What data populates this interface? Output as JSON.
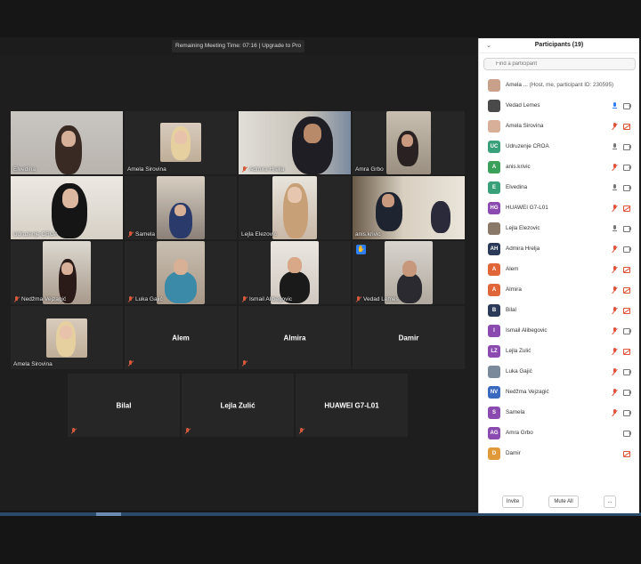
{
  "meeting": {
    "timer_text": "Remaining Meeting Time: 07:16 | Upgrade to Pro"
  },
  "tiles": [
    {
      "name": "Elvedina"
    },
    {
      "name": "Amela Sirovina"
    },
    {
      "name": "Admira Hrelja"
    },
    {
      "name": "Amra Grbo"
    },
    {
      "name": "Udruzenje CROA"
    },
    {
      "name": "Samela"
    },
    {
      "name": "Lejla Elezovic"
    },
    {
      "name": "anis.krivic"
    },
    {
      "name": "Nedžma Vejzagić"
    },
    {
      "name": "Luka Gajić"
    },
    {
      "name": "Ismail Alibegovic"
    },
    {
      "name": "Vedad Lemes"
    },
    {
      "name": "Amela Sirovina"
    },
    {
      "name": "Alem"
    },
    {
      "name": "Almira"
    },
    {
      "name": "Damir"
    },
    {
      "name": "Bilal"
    },
    {
      "name": "Lejla Zulić"
    },
    {
      "name": "HUAWEI G7-L01"
    }
  ],
  "participants_panel": {
    "title": "Participants (19)",
    "search_placeholder": "Find a participant",
    "invite_label": "Invite",
    "mute_all_label": "Mute All",
    "more_label": "...",
    "participants": [
      {
        "name": "Amela ...",
        "extra": "(Host, me, participant ID: 230595)",
        "initials": "",
        "avatar_color": "#c9a08a",
        "mic": "none",
        "cam": "none"
      },
      {
        "name": "Vedad Lemes",
        "initials": "",
        "avatar_color": "#4a4a4a",
        "mic": "blue",
        "cam": "ok"
      },
      {
        "name": "Amela Sirovina",
        "initials": "",
        "avatar_color": "#d8b09a",
        "mic": "red",
        "cam": "red"
      },
      {
        "name": "Udruzenje CROA",
        "initials": "UC",
        "avatar_color": "#3aa07a",
        "mic": "ok",
        "cam": "ok"
      },
      {
        "name": "anis.krivic",
        "initials": "A",
        "avatar_color": "#3aa05a",
        "mic": "red",
        "cam": "ok"
      },
      {
        "name": "Elvedina",
        "initials": "E",
        "avatar_color": "#3aa07a",
        "mic": "ok",
        "cam": "ok"
      },
      {
        "name": "HUAWEI G7-L01",
        "initials": "HG",
        "avatar_color": "#8a4ab0",
        "mic": "red",
        "cam": "red"
      },
      {
        "name": "Lejla Elezovic",
        "initials": "",
        "avatar_color": "#8a7868",
        "mic": "ok",
        "cam": "ok"
      },
      {
        "name": "Admira Hrelja",
        "initials": "AH",
        "avatar_color": "#2c3a5a",
        "mic": "red",
        "cam": "ok"
      },
      {
        "name": "Alem",
        "initials": "A",
        "avatar_color": "#e0663a",
        "mic": "red",
        "cam": "red"
      },
      {
        "name": "Almira",
        "initials": "A",
        "avatar_color": "#e0663a",
        "mic": "red",
        "cam": "red"
      },
      {
        "name": "Bilal",
        "initials": "B",
        "avatar_color": "#2c3a5a",
        "mic": "red",
        "cam": "red"
      },
      {
        "name": "Ismail Alibegovic",
        "initials": "I",
        "avatar_color": "#8a4ab0",
        "mic": "red",
        "cam": "ok"
      },
      {
        "name": "Lejla Zulić",
        "initials": "LZ",
        "avatar_color": "#8a4ab0",
        "mic": "red",
        "cam": "red"
      },
      {
        "name": "Luka Gajić",
        "initials": "",
        "avatar_color": "#7a8a9a",
        "mic": "red",
        "cam": "ok"
      },
      {
        "name": "Nedžma Vejzagić",
        "initials": "NV",
        "avatar_color": "#3a6ac0",
        "mic": "red",
        "cam": "ok"
      },
      {
        "name": "Samela",
        "initials": "S",
        "avatar_color": "#8a4ab0",
        "mic": "red",
        "cam": "ok"
      },
      {
        "name": "Amra Grbo",
        "initials": "AG",
        "avatar_color": "#8a4ab0",
        "mic": "none",
        "cam": "ok"
      },
      {
        "name": "Damir",
        "initials": "D",
        "avatar_color": "#e09a3a",
        "mic": "none",
        "cam": "red"
      }
    ]
  }
}
